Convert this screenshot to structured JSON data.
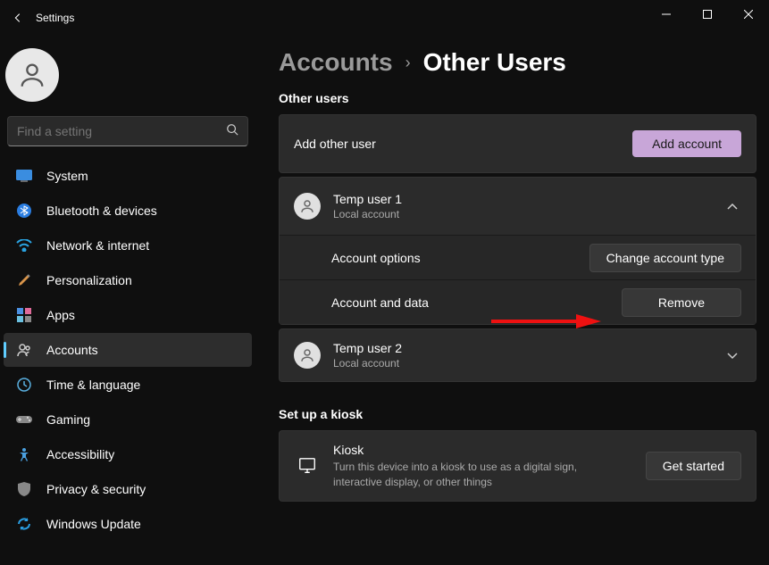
{
  "window": {
    "title": "Settings"
  },
  "search": {
    "placeholder": "Find a setting"
  },
  "sidebar": {
    "items": [
      {
        "label": "System"
      },
      {
        "label": "Bluetooth & devices"
      },
      {
        "label": "Network & internet"
      },
      {
        "label": "Personalization"
      },
      {
        "label": "Apps"
      },
      {
        "label": "Accounts"
      },
      {
        "label": "Time & language"
      },
      {
        "label": "Gaming"
      },
      {
        "label": "Accessibility"
      },
      {
        "label": "Privacy & security"
      },
      {
        "label": "Windows Update"
      }
    ]
  },
  "breadcrumb": {
    "parent": "Accounts",
    "current": "Other Users"
  },
  "sections": {
    "other_users_label": "Other users",
    "add_other_user": "Add other user",
    "add_account_btn": "Add account",
    "users": [
      {
        "name": "Temp user 1",
        "type": "Local account"
      },
      {
        "name": "Temp user 2",
        "type": "Local account"
      }
    ],
    "account_options": "Account options",
    "change_type_btn": "Change account type",
    "account_data": "Account and data",
    "remove_btn": "Remove",
    "kiosk_label": "Set up a kiosk",
    "kiosk_title": "Kiosk",
    "kiosk_desc": "Turn this device into a kiosk to use as a digital sign, interactive display, or other things",
    "get_started_btn": "Get started"
  }
}
